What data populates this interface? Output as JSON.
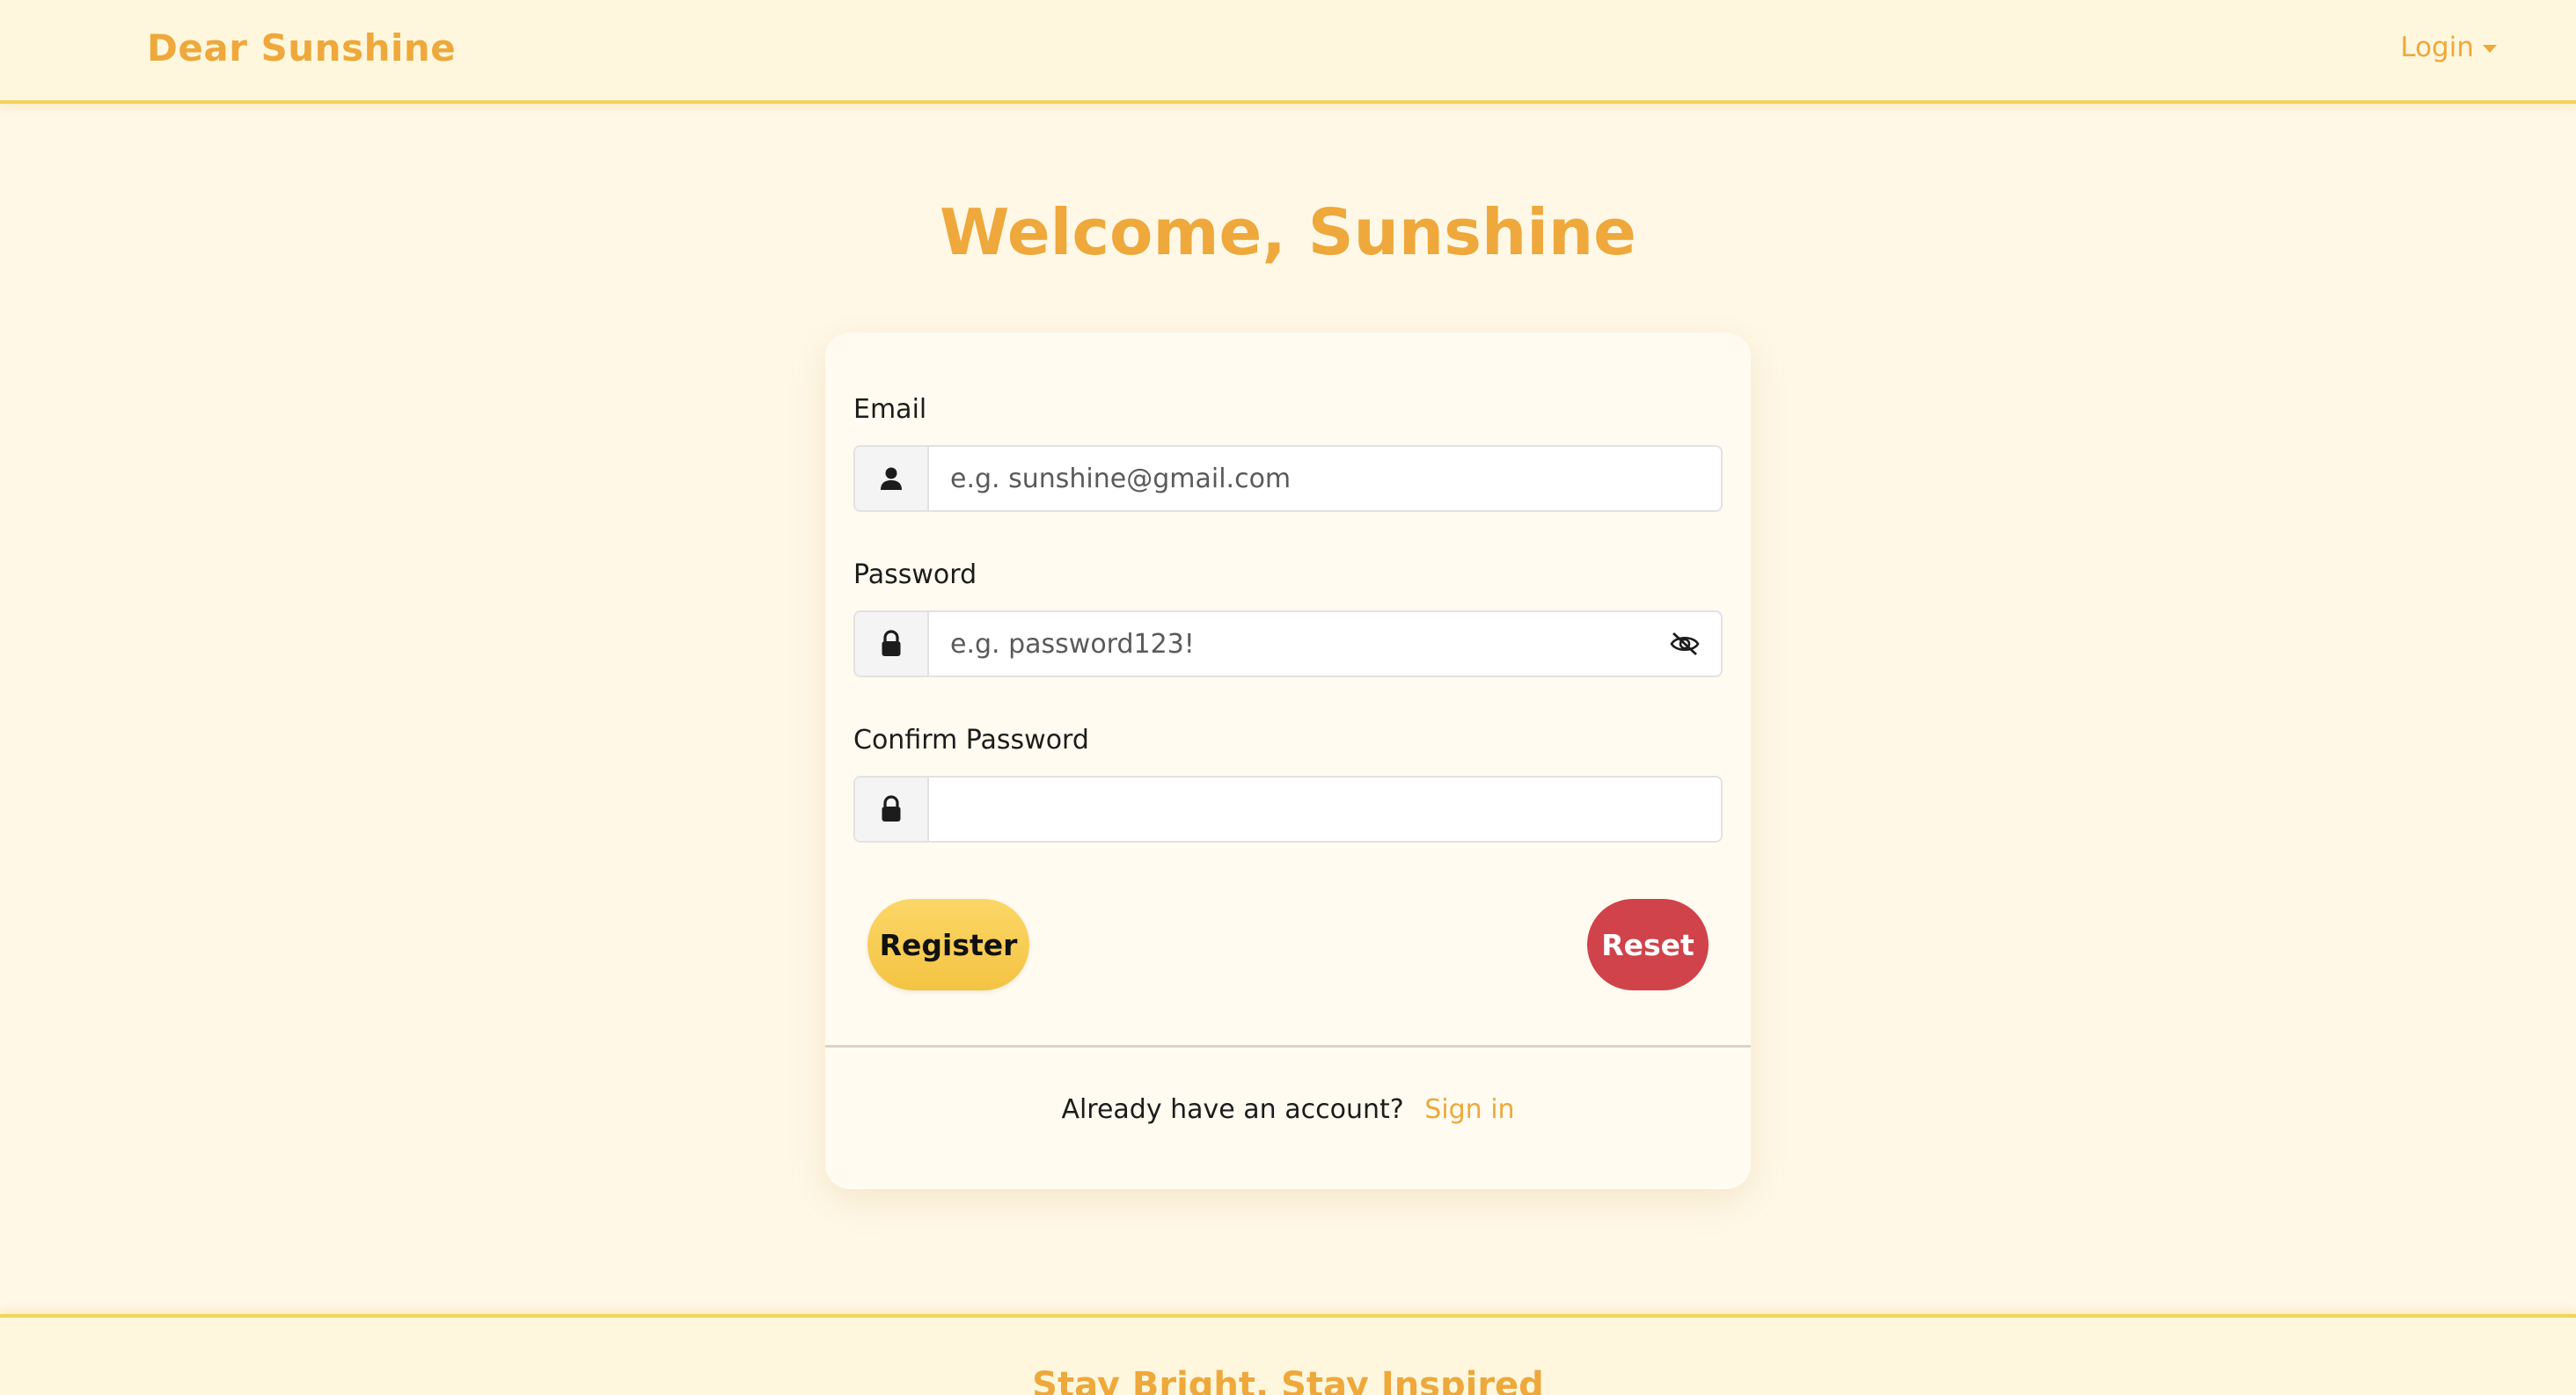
{
  "nav": {
    "brand": "Dear Sunshine",
    "login_label": "Login"
  },
  "page": {
    "title": "Welcome, Sunshine"
  },
  "form": {
    "email": {
      "label": "Email",
      "placeholder": "e.g. sunshine@gmail.com",
      "value": "",
      "icon": "user-icon"
    },
    "password": {
      "label": "Password",
      "placeholder": "e.g. password123!",
      "value": "",
      "icon": "lock-icon",
      "toggle_icon": "eye-slash-icon"
    },
    "confirm_password": {
      "label": "Confirm Password",
      "placeholder": "",
      "value": "",
      "icon": "lock-icon"
    },
    "register_label": "Register",
    "reset_label": "Reset"
  },
  "card_footer": {
    "prompt": "Already have an account?",
    "signin_label": "Sign in"
  },
  "footer": {
    "tagline": "Stay Bright, Stay Inspired"
  },
  "colors": {
    "accent": "#eea83b",
    "register": "#f4c342",
    "reset": "#d0434a",
    "background": "#fff8e7"
  }
}
